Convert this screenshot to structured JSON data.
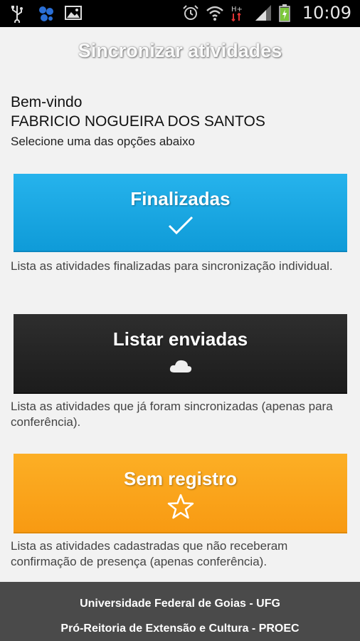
{
  "status_bar": {
    "time": "10:09",
    "icons": [
      "usb-icon",
      "app-notification-icon",
      "image-icon",
      "alarm-icon",
      "wifi-icon",
      "hplus-signal-icon",
      "signal-bars-icon",
      "battery-charging-icon"
    ]
  },
  "header": {
    "title": "Sincronizar atividades"
  },
  "welcome": {
    "greeting": "Bem-vindo",
    "user_name": "FABRICIO NOGUEIRA DOS SANTOS",
    "instruction": "Selecione uma das opções abaixo"
  },
  "actions": [
    {
      "label": "Finalizadas",
      "icon": "checkmark-icon",
      "color": "#1aa8e4",
      "description": "Lista as atividades finalizadas para sincronização individual."
    },
    {
      "label": "Listar enviadas",
      "icon": "cloud-icon",
      "color": "#252525",
      "description": "Lista as atividades que já foram sincronizadas (apenas para conferência)."
    },
    {
      "label": "Sem registro",
      "icon": "star-icon",
      "color": "#f9a51b",
      "description": "Lista as atividades cadastradas que não receberam confirmação de presença (apenas conferência)."
    }
  ],
  "footer": {
    "line1": "Universidade Federal de Goias - UFG",
    "line2": "Pró-Reitoria de Extensão e Cultura - PROEC"
  }
}
